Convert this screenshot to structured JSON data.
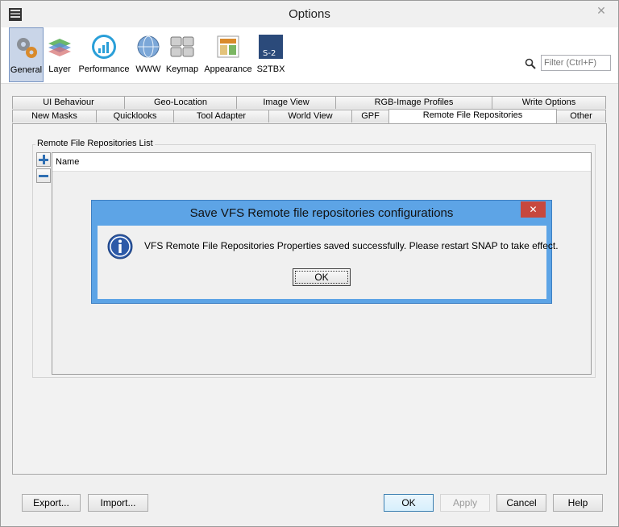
{
  "window": {
    "title": "Options"
  },
  "categories": [
    {
      "label": "General",
      "icon": "gears-icon",
      "selected": true
    },
    {
      "label": "Layer",
      "icon": "layer-stack-icon"
    },
    {
      "label": "Performance",
      "icon": "performance-chart-icon"
    },
    {
      "label": "WWW",
      "icon": "globe-icon"
    },
    {
      "label": "Keymap",
      "icon": "keyboard-icon"
    },
    {
      "label": "Appearance",
      "icon": "appearance-icon"
    },
    {
      "label": "S2TBX",
      "icon": "s2-snap-icon"
    }
  ],
  "search": {
    "placeholder": "Filter (Ctrl+F)"
  },
  "tabs_row1": [
    "UI Behaviour",
    "Geo-Location",
    "Image View",
    "RGB-Image Profiles",
    "Write Options"
  ],
  "tabs_row2": [
    "New Masks",
    "Quicklooks",
    "Tool Adapter",
    "World View",
    "GPF",
    "Remote File Repositories",
    "Other"
  ],
  "active_tab": "Remote File Repositories",
  "panel": {
    "group_title": "Remote File Repositories List",
    "column_name": "Name"
  },
  "dialog": {
    "title": "Save VFS Remote file repositories configurations",
    "message": "VFS Remote File Repositories Properties saved successfully. Please restart SNAP to take effect.",
    "ok_label": "OK"
  },
  "buttons": {
    "export": "Export...",
    "import": "Import...",
    "ok": "OK",
    "apply": "Apply",
    "cancel": "Cancel",
    "help": "Help"
  },
  "colors": {
    "dialog_frame": "#5da4e6",
    "close_button": "#c7483e",
    "selected_category": "#c9d5e8"
  }
}
